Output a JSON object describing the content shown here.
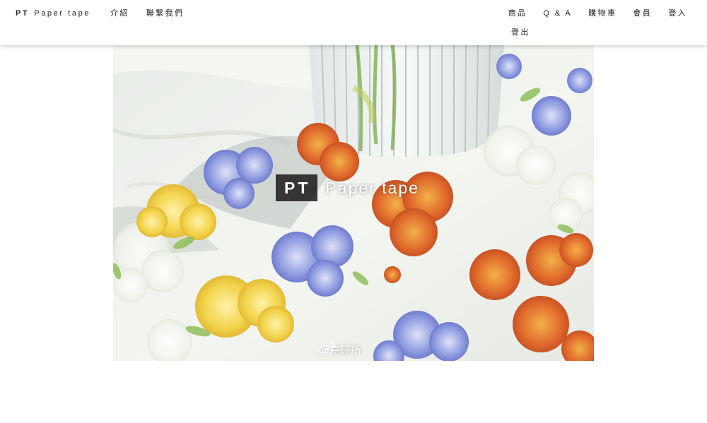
{
  "nav": {
    "brand_mark": "PT",
    "brand_name": "Paper tape",
    "left_links": [
      "介紹",
      "聯繫我們"
    ],
    "right_links": [
      "商品",
      "Q & A",
      "購物車",
      "會員",
      "登入"
    ],
    "logout": "登出"
  },
  "hero": {
    "logo_mark": "PT",
    "logo_text": "Paper tape",
    "watermark_text": "@基研所",
    "watermark_icon": "weibo-icon"
  },
  "colors": {
    "navbar_bg": "#ffffff",
    "text": "#222222",
    "logo_box": "#191919"
  }
}
